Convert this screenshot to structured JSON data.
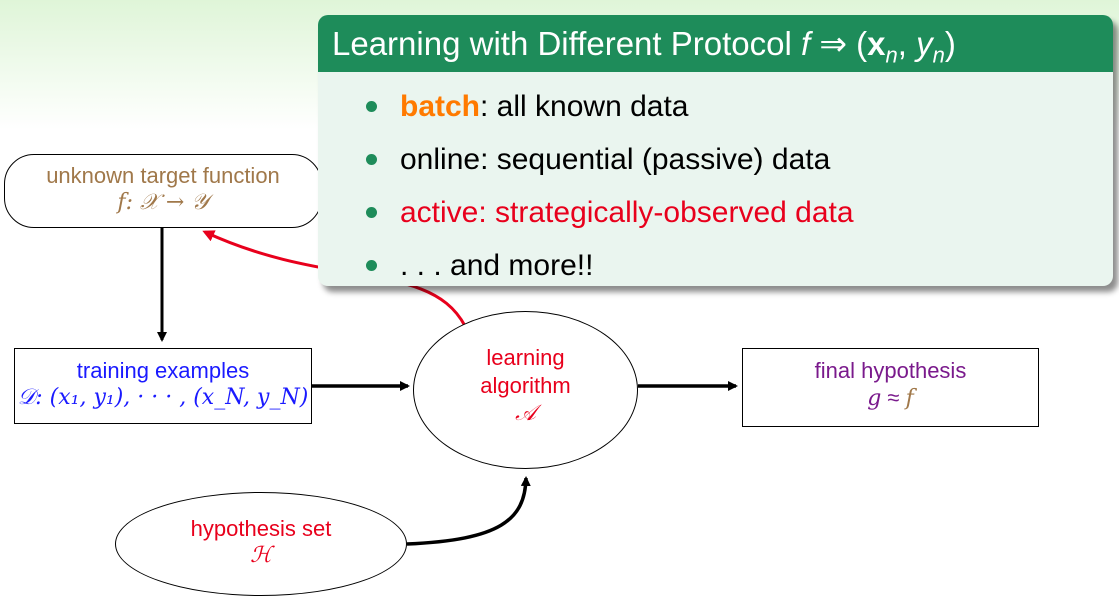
{
  "callout": {
    "title_text": "Learning with Different Protocol ",
    "title_f": "f",
    "title_arrow": " ⇒ (",
    "title_x": "x",
    "title_xsub": "n",
    "title_comma": ", ",
    "title_y": "y",
    "title_ysub": "n",
    "title_close": ")",
    "items": [
      {
        "keyword": "batch",
        "text": ": all known data"
      },
      {
        "text": "online: sequential (passive) data"
      },
      {
        "text": "active: strategically-observed data"
      },
      {
        "text": ". . . and more!!"
      }
    ]
  },
  "diagram": {
    "target": {
      "label": "unknown target function",
      "math": "f: 𝒳 → 𝒴"
    },
    "training": {
      "label": "training examples",
      "math": "𝒟: (x₁, y₁), · · · , (x_N, y_N)"
    },
    "algorithm": {
      "line1": "learning",
      "line2": "algorithm",
      "math": "𝒜"
    },
    "final": {
      "label": "final hypothesis",
      "math_g": "g",
      "math_op": " ≈ ",
      "math_f": "f"
    },
    "hypothesis": {
      "label": "hypothesis set",
      "math": "ℋ"
    }
  },
  "colors": {
    "accent_green": "#1e8c5a",
    "box_bg": "#eaf5ef",
    "highlight_orange": "#ff7a00",
    "red": "#e8001c",
    "blue": "#1a1aff",
    "purple": "#7a1a8c",
    "brown": "#a0784a"
  }
}
